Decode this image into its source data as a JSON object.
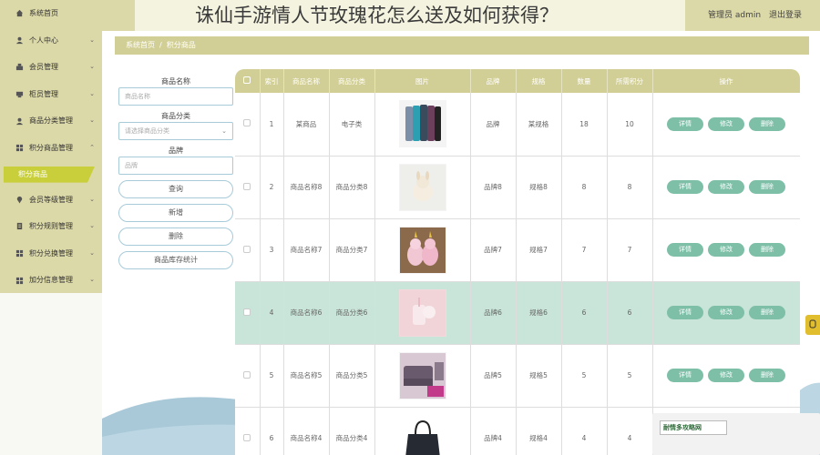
{
  "header": {
    "title": "诛仙手游情人节玫瑰花怎么送及如何获得？",
    "user": "管理员 admin",
    "logout": "退出登录"
  },
  "sidebar": {
    "items": [
      {
        "label": "系统首页",
        "icon": "home-icon",
        "chevron": false
      },
      {
        "label": "个人中心",
        "icon": "user-icon",
        "chevron": true
      },
      {
        "label": "会员管理",
        "icon": "member-icon",
        "chevron": true
      },
      {
        "label": "柜员管理",
        "icon": "counter-icon",
        "chevron": true
      },
      {
        "label": "商品分类管理",
        "icon": "category-icon",
        "chevron": true
      },
      {
        "label": "积分商品管理",
        "icon": "grid-icon",
        "chevron": "up"
      }
    ],
    "active_sub": "积分商品",
    "items_after": [
      {
        "label": "会员等级管理",
        "icon": "pin-icon",
        "chevron": true
      },
      {
        "label": "积分规则管理",
        "icon": "rule-icon",
        "chevron": true
      },
      {
        "label": "积分兑换管理",
        "icon": "grid-icon",
        "chevron": true
      },
      {
        "label": "加分信息管理",
        "icon": "grid-icon",
        "chevron": true
      }
    ]
  },
  "breadcrumb": {
    "home": "系统首页",
    "separator": "/",
    "current": "积分商品"
  },
  "form": {
    "name_label": "商品名称",
    "name_placeholder": "商品名称",
    "category_label": "商品分类",
    "category_placeholder": "请选择商品分类",
    "brand_label": "品牌",
    "brand_placeholder": "品牌",
    "buttons": [
      "查询",
      "新增",
      "删除",
      "商品库存统计"
    ]
  },
  "table": {
    "headers": [
      "",
      "索引",
      "商品名称",
      "商品分类",
      "图片",
      "品牌",
      "规格",
      "数量",
      "所需积分",
      "操作"
    ],
    "rows": [
      {
        "index": "1",
        "name": "某商品",
        "category": "电子类",
        "image": "phone-image",
        "brand": "品牌",
        "spec": "某规格",
        "qty": "18",
        "points": "10"
      },
      {
        "index": "2",
        "name": "商品名称8",
        "category": "商品分类8",
        "image": "plush-image",
        "brand": "品牌8",
        "spec": "规格8",
        "qty": "8",
        "points": "8"
      },
      {
        "index": "3",
        "name": "商品名称7",
        "category": "商品分类7",
        "image": "unicorn-image",
        "brand": "品牌7",
        "spec": "规格7",
        "qty": "7",
        "points": "7"
      },
      {
        "index": "4",
        "name": "商品名称6",
        "category": "商品分类6",
        "image": "cup-image",
        "brand": "品牌6",
        "spec": "规格6",
        "qty": "6",
        "points": "6"
      },
      {
        "index": "5",
        "name": "商品名称5",
        "category": "商品分类5",
        "image": "sofa-image",
        "brand": "品牌5",
        "spec": "规格5",
        "qty": "5",
        "points": "5"
      },
      {
        "index": "6",
        "name": "商品名称4",
        "category": "商品分类4",
        "image": "bag-image",
        "brand": "品牌4",
        "spec": "规格4",
        "qty": "4",
        "points": "4"
      }
    ],
    "actions": [
      "详情",
      "修改",
      "删除"
    ]
  },
  "watermark": "耐情多攻略网",
  "colors": {
    "accent": "#d2cf96",
    "sidebar": "#dcd9a8",
    "active": "#c8cf3a",
    "op_button": "#7ebfa8",
    "highlight_row": "#c9e4d8"
  }
}
